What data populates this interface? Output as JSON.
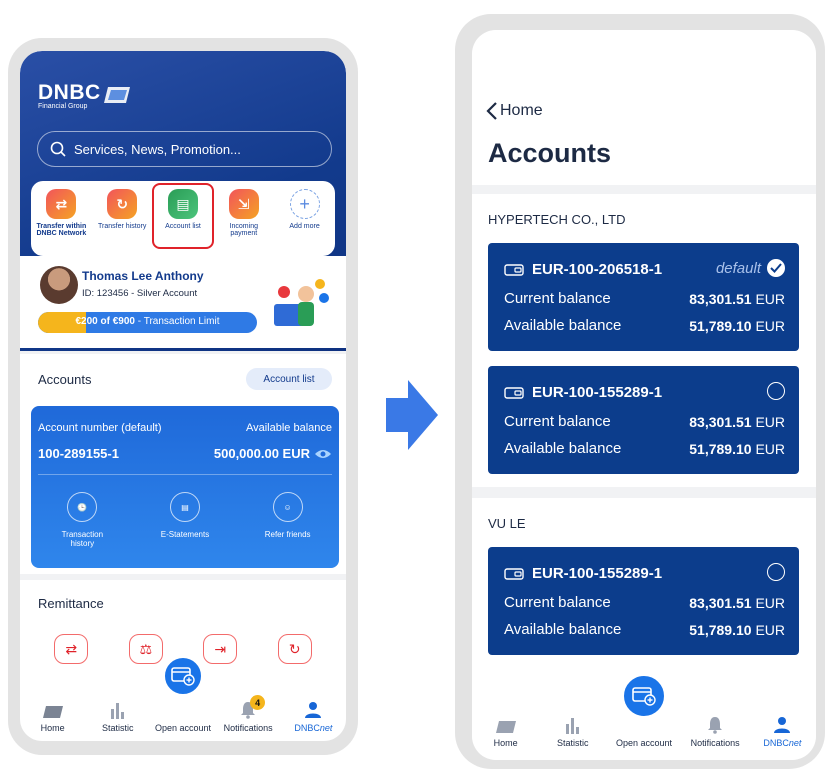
{
  "left_phone": {
    "logo": {
      "text": "DNBC",
      "sub": "Financial Group"
    },
    "search": {
      "placeholder": "Services, News, Promotion..."
    },
    "quick_actions": [
      {
        "label_bold": "Transfer within",
        "label_bold2": "DNBC Network",
        "color": "#e8383d"
      },
      {
        "label": "Transfer history",
        "color": "#e8383d"
      },
      {
        "label": "Account list",
        "color": "#2a9d56"
      },
      {
        "label": "Incoming",
        "label2": "payment",
        "color": "#e8383d"
      },
      {
        "label": "Add more"
      }
    ],
    "profile": {
      "name": "Thomas Lee Anthony",
      "id": "ID: 123456 - Silver Account",
      "limit_used": "€200 of €900",
      "limit_label": "- Transaction Limit",
      "limit_fraction": 0.22
    },
    "accounts": {
      "title": "Accounts",
      "list_button": "Account list",
      "number_label": "Account number (default)",
      "balance_label": "Available balance",
      "number": "100-289155-1",
      "balance": "500,000.00 EUR",
      "actions": [
        {
          "label": "Transaction",
          "label2": "history",
          "icon": "history-icon"
        },
        {
          "label": "E-Statements",
          "icon": "statement-icon"
        },
        {
          "label": "Refer friends",
          "icon": "friends-icon"
        }
      ]
    },
    "remittance": {
      "title": "Remittance"
    },
    "nav": {
      "home": "Home",
      "statistic": "Statistic",
      "open_account": "Open account",
      "notifications": "Notifications",
      "notification_count": "4",
      "dnbc": "DNBC",
      "dnbc_suffix": "net"
    }
  },
  "right_phone": {
    "back": "Home",
    "title": "Accounts",
    "groups": [
      {
        "name": "HYPERTECH CO., LTD",
        "accounts": [
          {
            "number": "EUR-100-206518-1",
            "default_text": "default",
            "selected": true,
            "current_label": "Current balance",
            "current": "83,301.51",
            "available_label": "Available balance",
            "available": "51,789.10",
            "currency": "EUR"
          },
          {
            "number": "EUR-100-155289-1",
            "selected": false,
            "current_label": "Current balance",
            "current": "83,301.51",
            "available_label": "Available balance",
            "available": "51,789.10",
            "currency": "EUR"
          }
        ]
      },
      {
        "name": "VU LE",
        "accounts": [
          {
            "number": "EUR-100-155289-1",
            "selected": false,
            "current_label": "Current balance",
            "current": "83,301.51",
            "available_label": "Available balance",
            "available": "51,789.10",
            "currency": "EUR"
          }
        ]
      }
    ],
    "nav": {
      "home": "Home",
      "statistic": "Statistic",
      "open_account": "Open account",
      "notifications": "Notifications",
      "dnbc": "DNBC",
      "dnbc_suffix": "net"
    }
  }
}
